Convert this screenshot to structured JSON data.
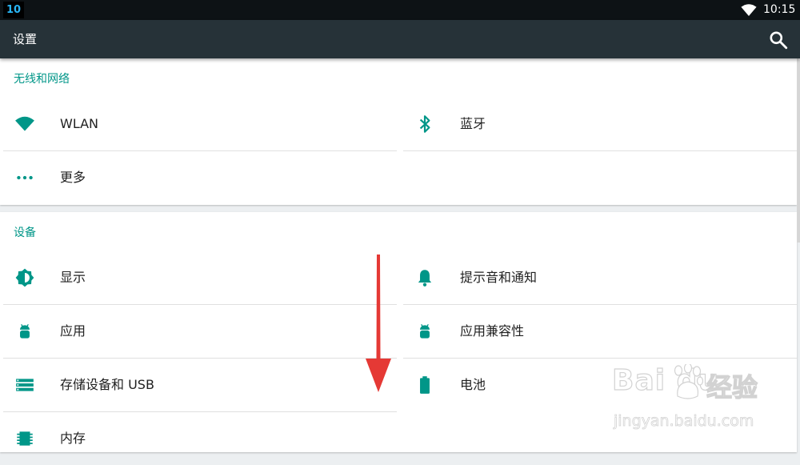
{
  "status_bar": {
    "notification_badge": "10",
    "time": "10:15"
  },
  "app_bar": {
    "title": "设置"
  },
  "colors": {
    "accent": "#009688",
    "app_bar": "#263238",
    "status_bar": "#0d1215",
    "arrow": "#e53935"
  },
  "sections": [
    {
      "title": "无线和网络",
      "items": [
        {
          "label": "WLAN",
          "icon": "wifi-icon"
        },
        {
          "label": "蓝牙",
          "icon": "bluetooth-icon"
        },
        {
          "label": "更多",
          "icon": "more-horiz-icon"
        }
      ]
    },
    {
      "title": "设备",
      "items": [
        {
          "label": "显示",
          "icon": "brightness-icon"
        },
        {
          "label": "提示音和通知",
          "icon": "bell-icon"
        },
        {
          "label": "应用",
          "icon": "android-icon"
        },
        {
          "label": "应用兼容性",
          "icon": "android-icon"
        },
        {
          "label": "存储设备和 USB",
          "icon": "storage-icon"
        },
        {
          "label": "电池",
          "icon": "battery-icon"
        },
        {
          "label": "内存",
          "icon": "memory-chip-icon"
        }
      ]
    }
  ],
  "watermark": {
    "brand": "Bai du",
    "logo_text": "经验",
    "url": "jingyan.baidu.com"
  }
}
